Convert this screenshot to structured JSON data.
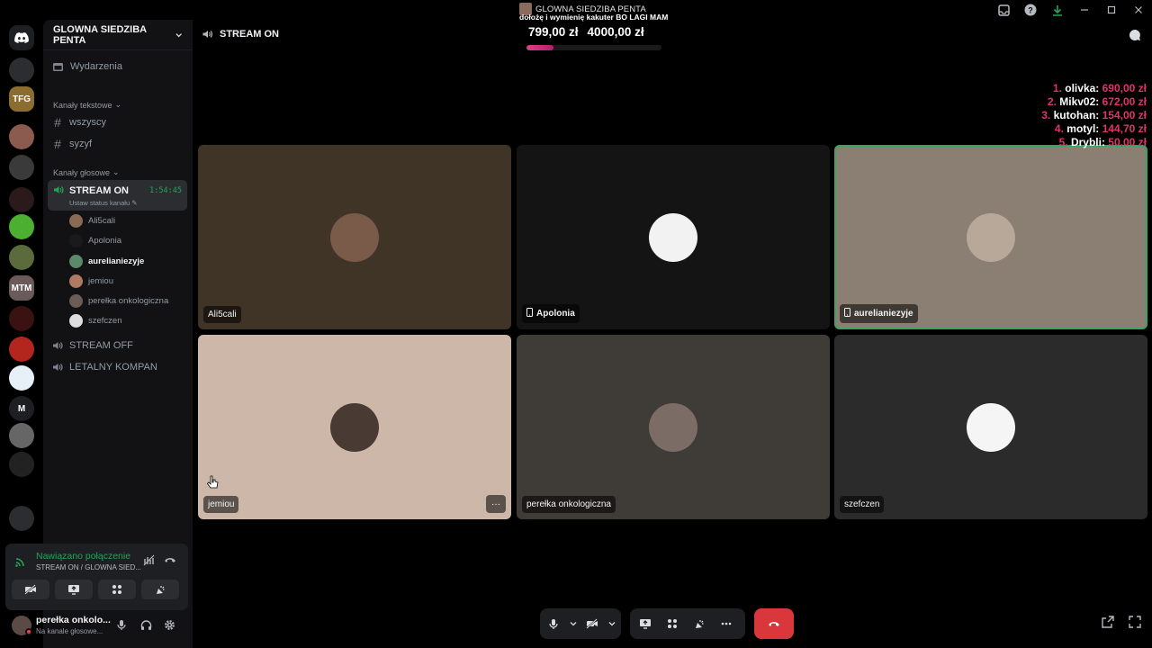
{
  "window": {
    "title": "GLOWNA SIEDZIBA PENTA"
  },
  "overlay": {
    "subtitle": "dołożę i wymienię kakuter BO LAGI MAM",
    "current_amount": "799,00 zł",
    "goal_amount": "4000,00 zł",
    "progress_fraction": 0.2,
    "leaderboard": [
      {
        "rank": "1.",
        "name": "olivka:",
        "amount": "690,00 zł"
      },
      {
        "rank": "2.",
        "name": "Mikv02:",
        "amount": "672,00 zł"
      },
      {
        "rank": "3.",
        "name": "kutohan:",
        "amount": "154,00 zł"
      },
      {
        "rank": "4.",
        "name": "motyl:",
        "amount": "144,70 zł"
      },
      {
        "rank": "5.",
        "name": "Drybli:",
        "amount": "50,00 zł"
      }
    ]
  },
  "rail": {
    "icons": [
      {
        "name": "discord-home-icon",
        "label": "",
        "color": "#1e1f22"
      },
      {
        "name": "server-icon-1",
        "label": "",
        "color": "#2b2d31"
      },
      {
        "name": "server-icon-tfg",
        "label": "TFG",
        "color": "#8a6d2f"
      },
      {
        "name": "server-icon-penta",
        "label": "",
        "color": "#8c5b50"
      },
      {
        "name": "server-icon-4",
        "label": "",
        "color": "#3a3a3a"
      },
      {
        "name": "server-icon-5",
        "label": "",
        "color": "#2a1a1a"
      },
      {
        "name": "server-icon-apple",
        "label": "",
        "color": "#4caf32"
      },
      {
        "name": "server-icon-7",
        "label": "",
        "color": "#5b6b3c"
      },
      {
        "name": "server-icon-mtm",
        "label": "MTM",
        "color": "#6b5a5a"
      },
      {
        "name": "server-icon-9",
        "label": "",
        "color": "#3a1212"
      },
      {
        "name": "server-icon-10",
        "label": "",
        "color": "#b3261e"
      },
      {
        "name": "server-icon-medic",
        "label": "",
        "color": "#e8f0f7"
      },
      {
        "name": "server-icon-m",
        "label": "M",
        "color": "#1e1f22"
      },
      {
        "name": "server-icon-13",
        "label": "",
        "color": "#666"
      },
      {
        "name": "server-icon-14",
        "label": "",
        "color": "#222"
      },
      {
        "name": "server-icon-folder",
        "label": "",
        "color": "#2b2d31"
      }
    ]
  },
  "sidebar": {
    "server_name": "GLOWNA SIEDZIBA PENTA",
    "events_label": "Wydarzenia",
    "text_category": "Kanały tekstowe",
    "text_channels": [
      "wszyscy",
      "syzyf"
    ],
    "voice_category": "Kanały głosowe",
    "active_voice": {
      "name": "STREAM ON",
      "time": "1:54:45",
      "status": "Ustaw status kanału"
    },
    "members": [
      {
        "name": "Ali5cali",
        "bold": false,
        "color": "#8a6a55"
      },
      {
        "name": "Apolonia",
        "bold": false,
        "color": "#1a1a1a"
      },
      {
        "name": "aurelianiezyje",
        "bold": true,
        "color": "#5a8a6a"
      },
      {
        "name": "jemiou",
        "bold": false,
        "color": "#b07a62"
      },
      {
        "name": "perełka onkologiczna",
        "bold": false,
        "color": "#6b5c55"
      },
      {
        "name": "szefczen",
        "bold": false,
        "color": "#dddddd"
      }
    ],
    "other_voice": [
      "STREAM OFF",
      "LETALNY KOMPAN"
    ]
  },
  "voice_panel": {
    "connected": "Nawiązano połączenie",
    "location": "STREAM ON / GLOWNA SIED..."
  },
  "user_panel": {
    "name": "perełka onkolo...",
    "status": "Na kanale głosowe..."
  },
  "main": {
    "channel": "STREAM ON",
    "tiles": [
      {
        "name": "Ali5cali",
        "bg": "#3f3426",
        "avatar": "#7a5a48",
        "mobile": false,
        "speaking": false,
        "more": false
      },
      {
        "name": "Apolonia",
        "bg": "#141414",
        "avatar": "#f2f2f2",
        "mobile": true,
        "speaking": false,
        "more": false
      },
      {
        "name": "aurelianiezyje",
        "bg": "#8a7f72",
        "avatar": "#b8a89a",
        "mobile": true,
        "speaking": true,
        "more": false
      },
      {
        "name": "jemiou",
        "bg": "#cdb7a8",
        "avatar": "#4a3a34",
        "mobile": false,
        "speaking": false,
        "more": true
      },
      {
        "name": "perełka onkologiczna",
        "bg": "#3f3b37",
        "avatar": "#7b6c66",
        "mobile": false,
        "speaking": false,
        "more": false
      },
      {
        "name": "szefczen",
        "bg": "#2b2b2b",
        "avatar": "#f5f5f5",
        "mobile": false,
        "speaking": false,
        "more": false
      }
    ]
  }
}
